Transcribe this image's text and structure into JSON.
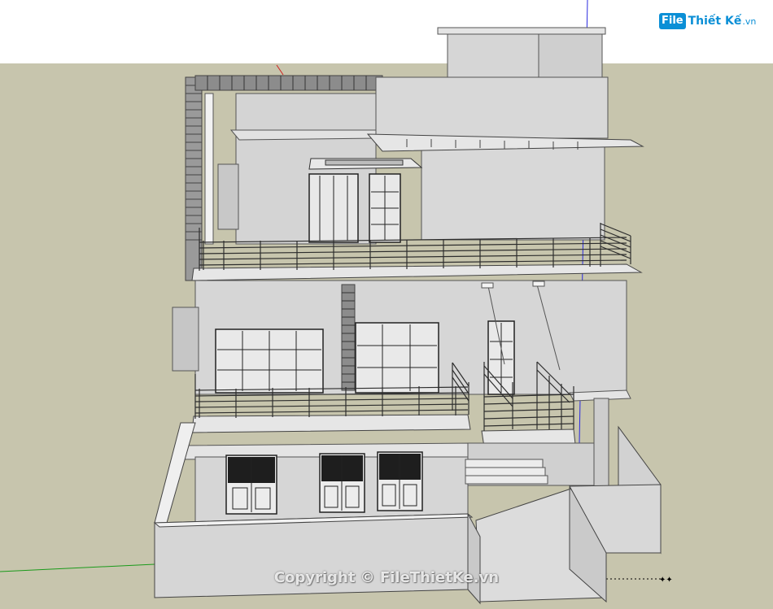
{
  "watermark": {
    "logo_badge": "File",
    "logo_name": "Thiết Kế",
    "logo_tld": ".vn",
    "copyright": "Copyright © FileThietKe.vn"
  },
  "colors": {
    "sky": "#ffffff",
    "ground": "#c7c5ad",
    "wall": "#d6d6d6",
    "wall_shade": "#bdbdbd",
    "railing": "#3a3a3a",
    "axis_blue": "#2a2ae0",
    "axis_green": "#1a9a1a",
    "axis_red": "#d02020",
    "logo_blue": "#0b8fd6"
  }
}
